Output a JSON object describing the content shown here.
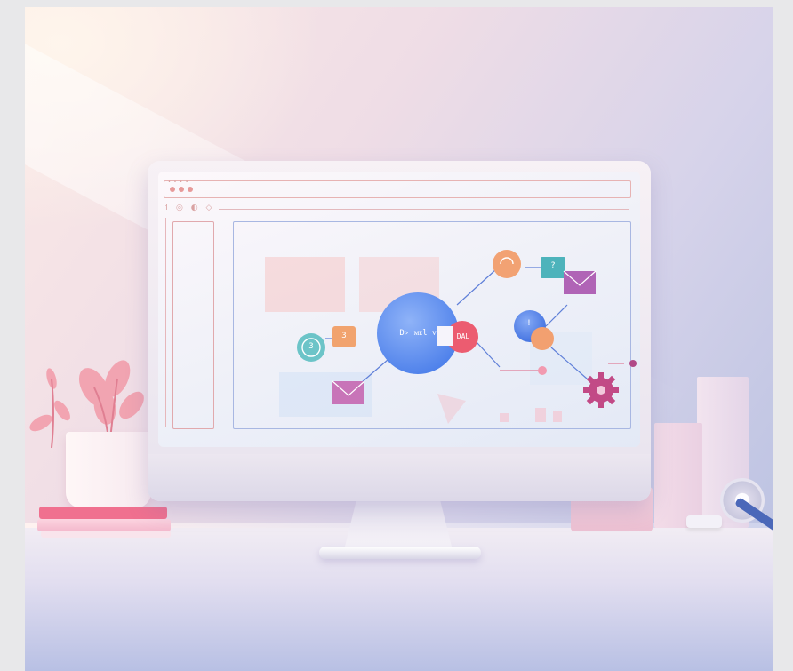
{
  "screen": {
    "sidebar_icons": "ſ ◎ ◐ ◇",
    "diagram": {
      "node_left_circle": "3",
      "node_orange_square": "3",
      "node_big_circle": "D› ᴍᴇl ᴠ",
      "node_red_badge": "DAL",
      "node_teal_square": "?",
      "node_small_blue": "!"
    }
  },
  "colors": {
    "accent_blue": "#5b8ef0",
    "accent_pink": "#f0708f",
    "accent_orange": "#f2a070",
    "accent_purple": "#b066b0",
    "accent_teal": "#4ab3b8"
  }
}
